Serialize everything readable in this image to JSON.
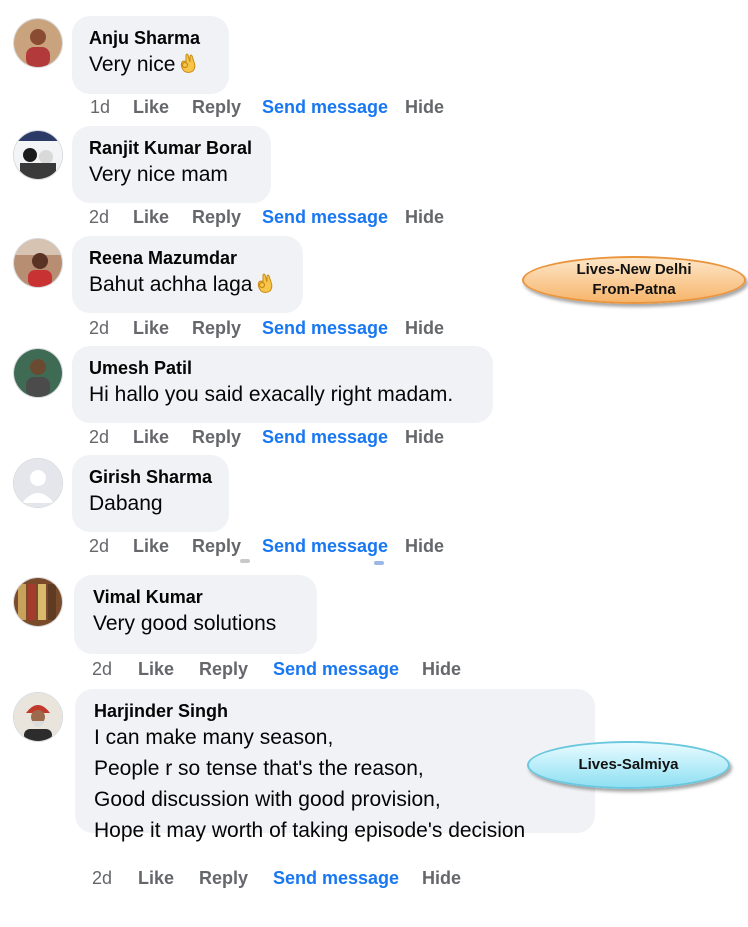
{
  "comments": [
    {
      "author": "Anju Sharma",
      "text": "Very nice",
      "emoji": "ok-hand-emoji",
      "time": "1d",
      "like": "Like",
      "reply": "Reply",
      "send": "Send message",
      "hide": "Hide"
    },
    {
      "author": "Ranjit Kumar Boral",
      "text": "Very nice mam",
      "time": "2d",
      "like": "Like",
      "reply": "Reply",
      "send": "Send message",
      "hide": "Hide"
    },
    {
      "author": "Reena Mazumdar",
      "text": "Bahut achha laga",
      "emoji": "ok-hand-emoji",
      "time": "2d",
      "like": "Like",
      "reply": "Reply",
      "send": "Send message",
      "hide": "Hide"
    },
    {
      "author": "Umesh Patil",
      "text": "Hi hallo you said exacally right madam.",
      "time": "2d",
      "like": "Like",
      "reply": "Reply",
      "send": "Send message",
      "hide": "Hide"
    },
    {
      "author": "Girish Sharma",
      "text": "Dabang",
      "time": "2d",
      "like": "Like",
      "reply": "Reply",
      "send": "Send message",
      "hide": "Hide"
    },
    {
      "author": "Vimal Kumar",
      "text": "Very good solutions",
      "time": "2d",
      "like": "Like",
      "reply": "Reply",
      "send": "Send message",
      "hide": "Hide"
    },
    {
      "author": "Harjinder Singh",
      "lines": [
        "I can make many season,",
        "People r so tense that's the reason,",
        "Good discussion with good provision,",
        "Hope it may worth of taking episode's decision"
      ],
      "time": "2d",
      "like": "Like",
      "reply": "Reply",
      "send": "Send message",
      "hide": "Hide"
    }
  ],
  "callouts": [
    {
      "lines": [
        "Lives-New Delhi",
        "From-Patna"
      ],
      "color": "#f7b56b"
    },
    {
      "lines": [
        "Lives-Salmiya"
      ],
      "color": "#8fe0f3"
    }
  ],
  "colors": {
    "bubble": "#f0f2f5",
    "link": "#1877f2",
    "meta": "#65676b"
  }
}
